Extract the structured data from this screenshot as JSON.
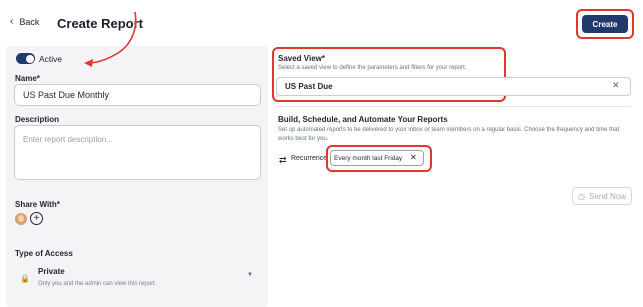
{
  "header": {
    "back_label": "Back",
    "title": "Create Report",
    "create_label": "Create"
  },
  "status": {
    "active_label": "Active",
    "active": true
  },
  "name_field": {
    "label": "Name*",
    "value": "US Past Due Monthly"
  },
  "description_field": {
    "label": "Description",
    "placeholder": "Enter report description..."
  },
  "share": {
    "label": "Share With*"
  },
  "access": {
    "label": "Type of Access",
    "option_title": "Private",
    "option_desc": "Only you and the admin can view this report."
  },
  "saved_view": {
    "label": "Saved View*",
    "description": "Select a saved view to define the parameters and filters for your report.",
    "value": "US Past Due"
  },
  "automation": {
    "title": "Build, Schedule, and Automate Your Reports",
    "description": "Set up automated reports to be delivered to your inbox or team members on a regular basis. Choose the frequency and time that works best for you.",
    "recurrence_label": "Recurrence",
    "recurrence_value": "Every month last Friday",
    "send_now_label": "Send Now"
  },
  "icons": {
    "back": "chevron-left-icon",
    "clear": "close-icon",
    "recurrence": "repeat-icon",
    "lock": "lock-icon",
    "add": "plus-circle-icon",
    "send": "clock-icon"
  },
  "colors": {
    "primary": "#1f3a6b",
    "annotation": "#e0382b"
  }
}
